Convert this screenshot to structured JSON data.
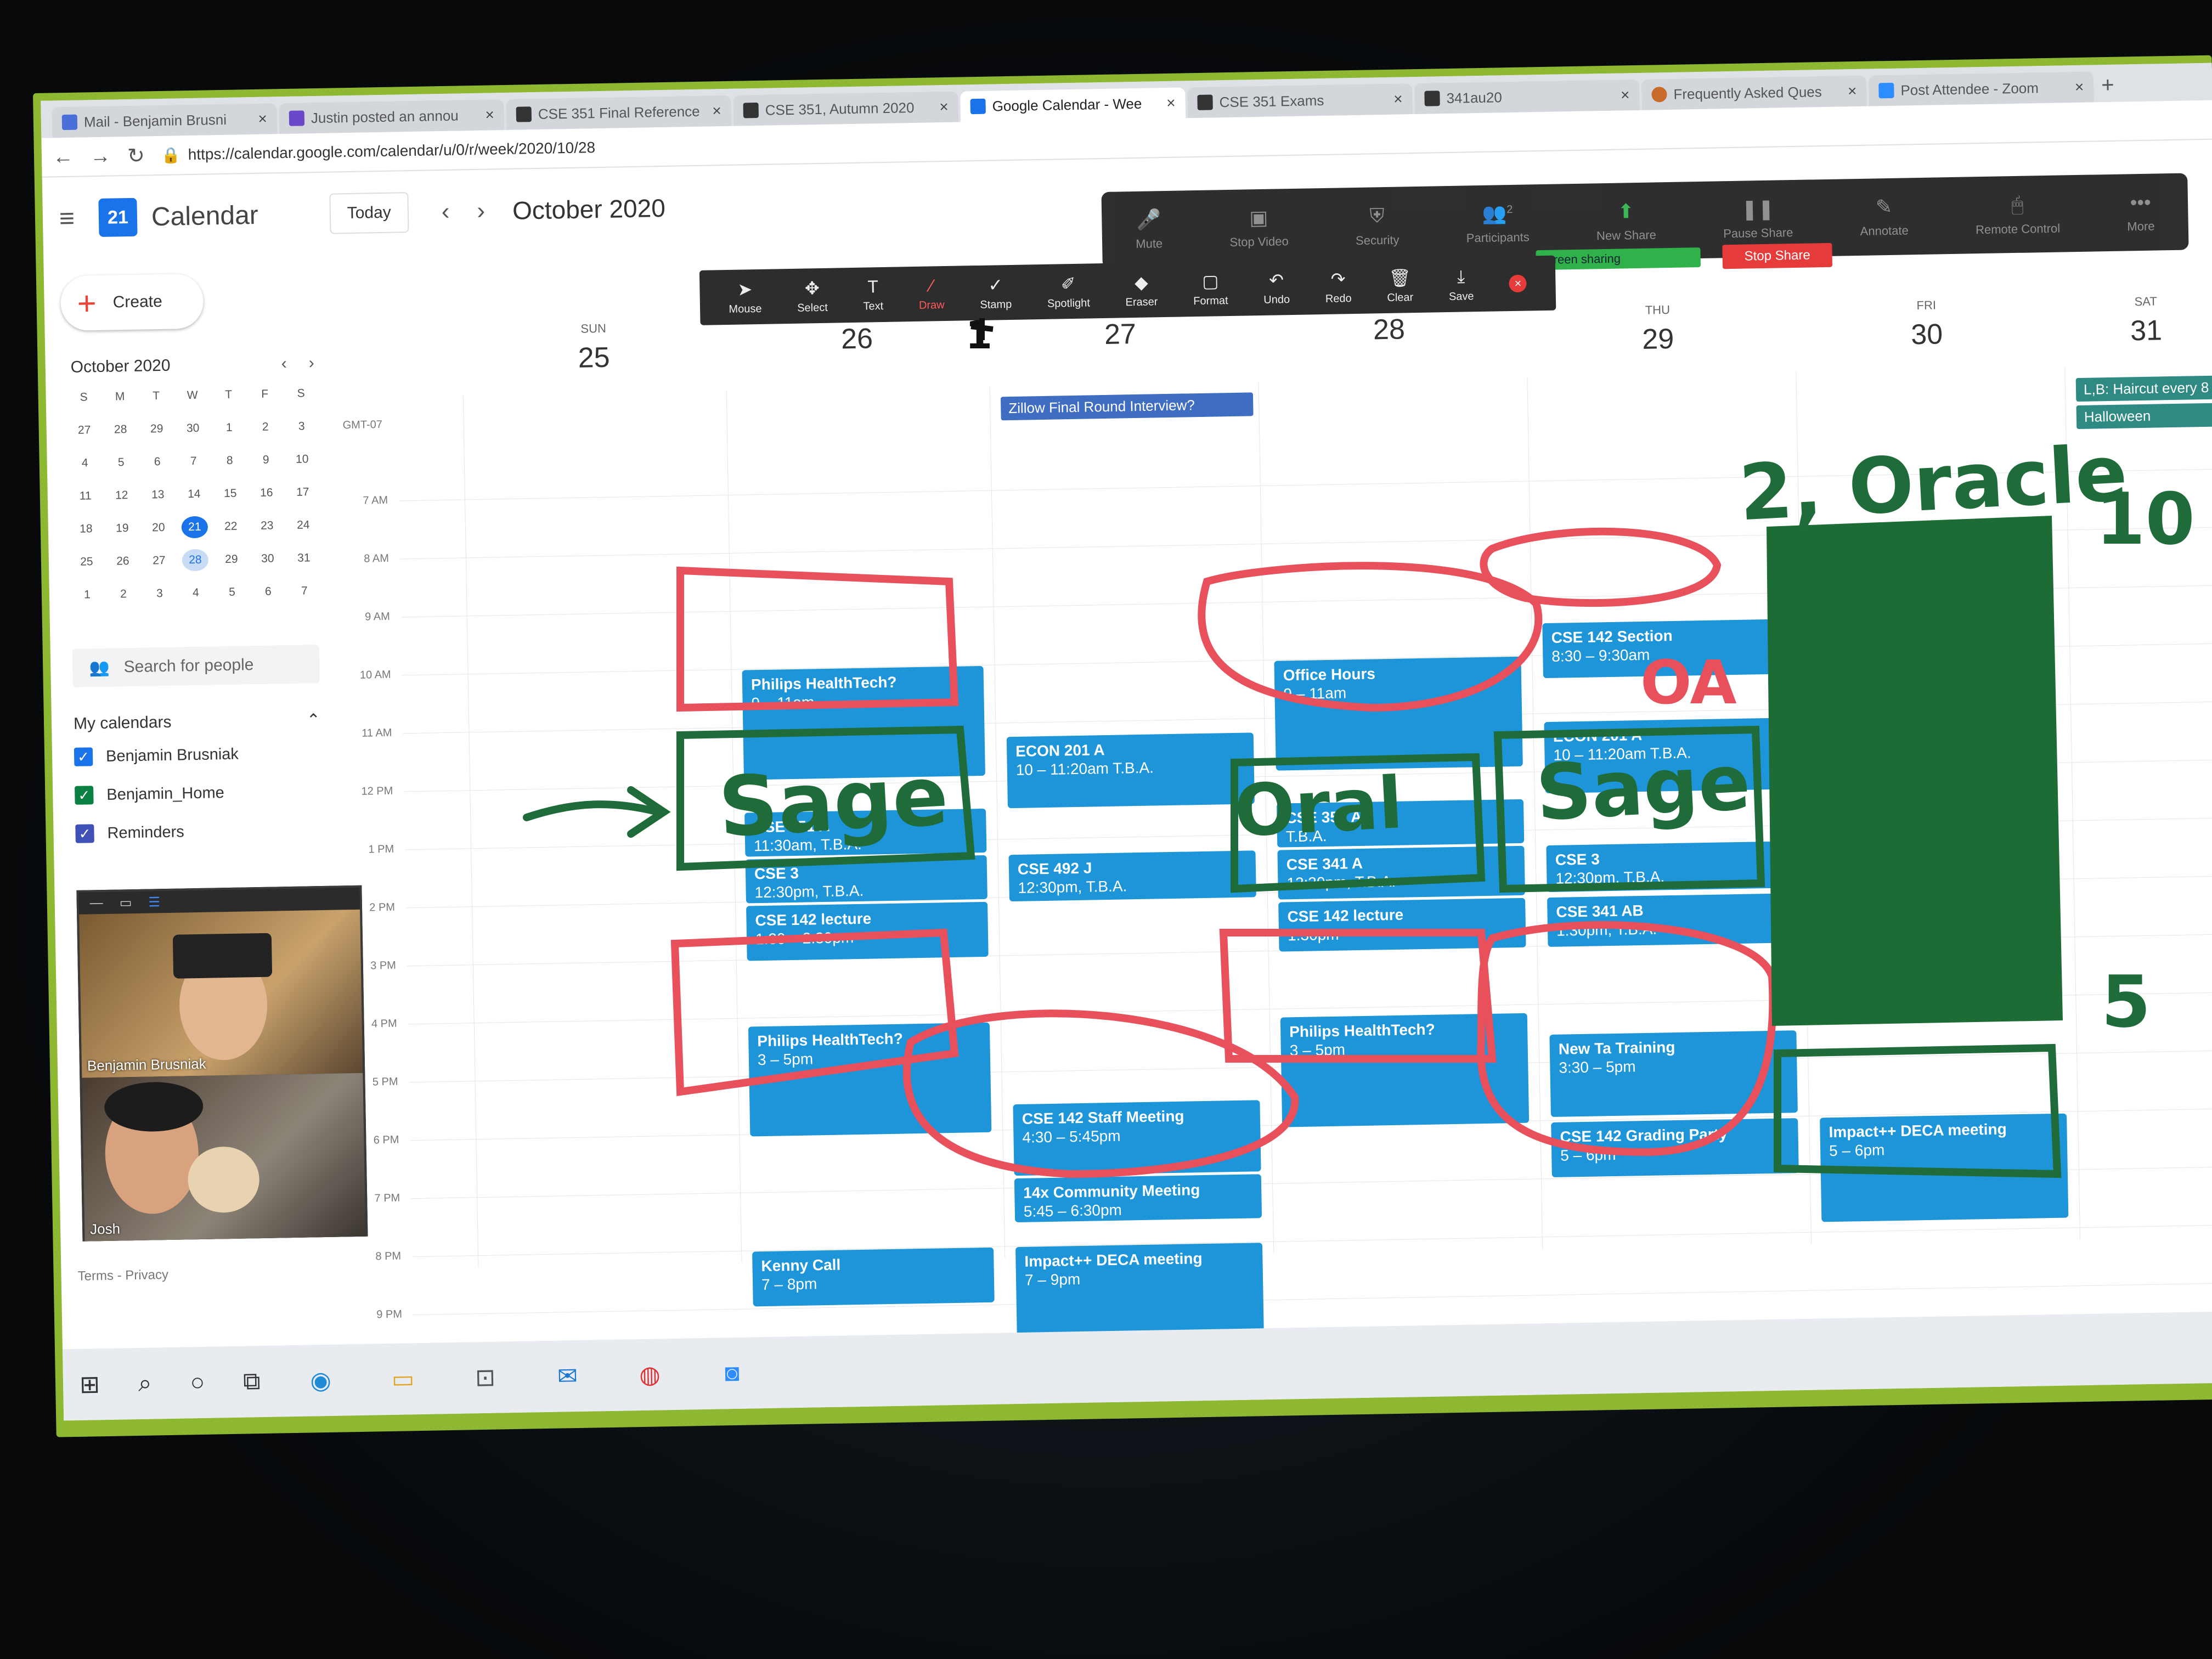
{
  "tabs": [
    {
      "title": "Mail - Benjamin Brusni",
      "close": "×"
    },
    {
      "title": "Justin posted an annou",
      "close": "×"
    },
    {
      "title": "CSE 351 Final Reference",
      "close": "×"
    },
    {
      "title": "CSE 351, Autumn 2020",
      "close": "×"
    },
    {
      "title": "Google Calendar - Wee",
      "close": "×"
    },
    {
      "title": "CSE 351 Exams",
      "close": "×"
    },
    {
      "title": "341au20",
      "close": "×"
    },
    {
      "title": "Frequently Asked Ques",
      "close": "×"
    },
    {
      "title": "Post Attendee - Zoom",
      "close": "×"
    }
  ],
  "new_tab": "+",
  "url": "https://calendar.google.com/calendar/u/0/r/week/2020/10/28",
  "header": {
    "logo_day": "21",
    "app_name": "Calendar",
    "today_btn": "Today",
    "month_title": "October 2020"
  },
  "zoom": {
    "controls": [
      "Mute",
      "Stop Video",
      "Security",
      "Participants",
      "New Share",
      "Pause Share",
      "Annotate",
      "Remote Control",
      "More"
    ],
    "participants_count": "2",
    "sharing_label": "screen sharing",
    "stop_share": "Stop Share"
  },
  "annotate_tools": [
    "Mouse",
    "Select",
    "Text",
    "Draw",
    "Stamp",
    "Spotlight",
    "Eraser",
    "Format",
    "Undo",
    "Redo",
    "Clear",
    "Save"
  ],
  "sidebar": {
    "create": "Create",
    "mini_month": "October 2020",
    "dow": [
      "S",
      "M",
      "T",
      "W",
      "T",
      "F",
      "S"
    ],
    "days": [
      "27",
      "28",
      "29",
      "30",
      "1",
      "2",
      "3",
      "4",
      "5",
      "6",
      "7",
      "8",
      "9",
      "10",
      "11",
      "12",
      "13",
      "14",
      "15",
      "16",
      "17",
      "18",
      "19",
      "20",
      "21",
      "22",
      "23",
      "24",
      "25",
      "26",
      "27",
      "28",
      "29",
      "30",
      "31",
      "1",
      "2",
      "3",
      "4",
      "5",
      "6",
      "7"
    ],
    "search_people": "Search for people",
    "my_calendars": "My calendars",
    "calendars": [
      "Benjamin Brusniak",
      "Benjamin_Home",
      "Reminders"
    ],
    "terms": "Terms - Privacy",
    "video_names": [
      "Benjamin Brusniak",
      "Josh"
    ]
  },
  "week": {
    "gmt": "GMT-07",
    "days": [
      {
        "name": "SUN",
        "date": "25"
      },
      {
        "name": "",
        "date": "26"
      },
      {
        "name": "",
        "date": "27"
      },
      {
        "name": "",
        "date": "28"
      },
      {
        "name": "THU",
        "date": "29"
      },
      {
        "name": "FRI",
        "date": "30"
      },
      {
        "name": "SAT",
        "date": "31"
      }
    ],
    "hours": [
      "7 AM",
      "8 AM",
      "9 AM",
      "10 AM",
      "11 AM",
      "12 PM",
      "1 PM",
      "2 PM",
      "3 PM",
      "4 PM",
      "5 PM",
      "6 PM",
      "7 PM",
      "8 PM",
      "9 PM"
    ],
    "allday": [
      "Zillow Final Round Interview?",
      "L,B: Haircut every 8 week",
      "Halloween"
    ],
    "events": [
      {
        "title": "Philips HealthTech?",
        "time": "9 – 11am"
      },
      {
        "title": "CSE 351 A",
        "time": "11:30am, T.B.A."
      },
      {
        "title": "CSE 3",
        "time": "12:30pm, T.B.A."
      },
      {
        "title": "CSE 142 lecture",
        "time": "1:30 – 2:30pm"
      },
      {
        "title": "Philips HealthTech?",
        "time": "3 – 5pm"
      },
      {
        "title": "Kenny Call",
        "time": "7 – 8pm"
      },
      {
        "title": "ECON 201 A",
        "time": "10 – 11:20am T.B.A."
      },
      {
        "title": "CSE 492 J",
        "time": "12:30pm, T.B.A."
      },
      {
        "title": "CSE 142 Staff Meeting",
        "time": "4:30 – 5:45pm"
      },
      {
        "title": "14x Community Meeting",
        "time": "5:45 – 6:30pm"
      },
      {
        "title": "Impact++ DECA meeting",
        "time": "7 – 9pm"
      },
      {
        "title": "Office Hours",
        "time": "9 – 11am"
      },
      {
        "title": "CSE 351 A",
        "time": "T.B.A."
      },
      {
        "title": "CSE 341 A",
        "time": "12:30pm, T.B.A."
      },
      {
        "title": "CSE 142 lecture",
        "time": "1:30pm"
      },
      {
        "title": "Philips HealthTech?",
        "time": "3 – 5pm"
      },
      {
        "title": "CSE 142 Section",
        "time": "8:30 – 9:30am"
      },
      {
        "title": "ECON 201 A",
        "time": "10 – 11:20am T.B.A."
      },
      {
        "title": "CSE 3",
        "time": "12:30pm, T.B.A."
      },
      {
        "title": "CSE 341 AB",
        "time": "1:30pm, T.B.A."
      },
      {
        "title": "New Ta Training",
        "time": "3:30 – 5pm"
      },
      {
        "title": "CSE 142 Grading Party",
        "time": "5 – 6pm"
      },
      {
        "title": "Impact++ DECA meeting",
        "time": "5 – 6pm"
      }
    ]
  },
  "annotations": {
    "sage_1": "Sage",
    "oral": "Oral",
    "sage_2": "Sage",
    "oracle": "2, Oracle",
    "ten": "10",
    "five": "5",
    "oa": "OA",
    "one": "1"
  },
  "colors": {
    "event_blue": "#1e95d8",
    "ink_red": "#e8505b",
    "ink_green": "#1f6b3a",
    "monitor_bezel": "#8fb832"
  }
}
